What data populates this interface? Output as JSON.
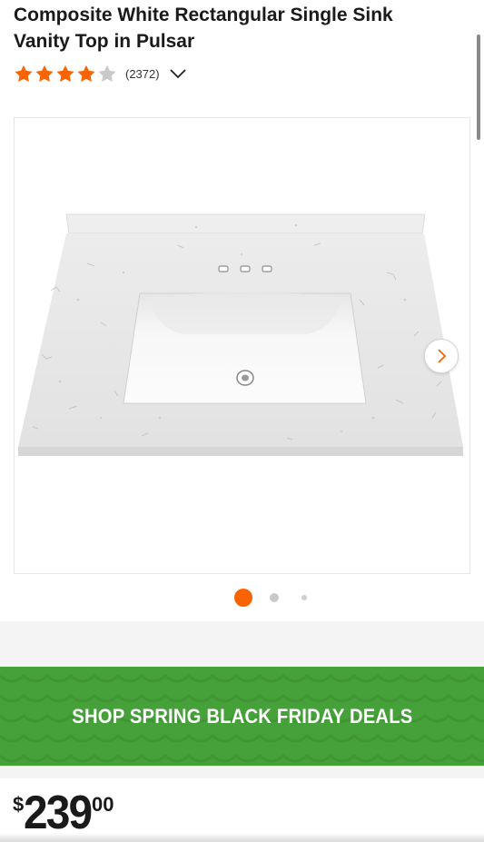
{
  "product": {
    "title": "Composite White Rectangular Single Sink Vanity Top in Pulsar",
    "rating": {
      "stars": 4,
      "max_stars": 5,
      "review_count": "(2372)"
    }
  },
  "gallery": {
    "image_name": "vanity-top-product-image",
    "active_index": 1,
    "dot_count": 3,
    "next_icon": "chevron-right-icon"
  },
  "promo": {
    "text": "SHOP SPRING BLACK FRIDAY DEALS"
  },
  "price": {
    "currency": "$",
    "dollars": "239",
    "cents": "00"
  },
  "colors": {
    "brand_orange": "#f96302",
    "star_filled": "#f96302",
    "star_empty": "#c9c9c9",
    "promo_green": "#47a13a"
  }
}
